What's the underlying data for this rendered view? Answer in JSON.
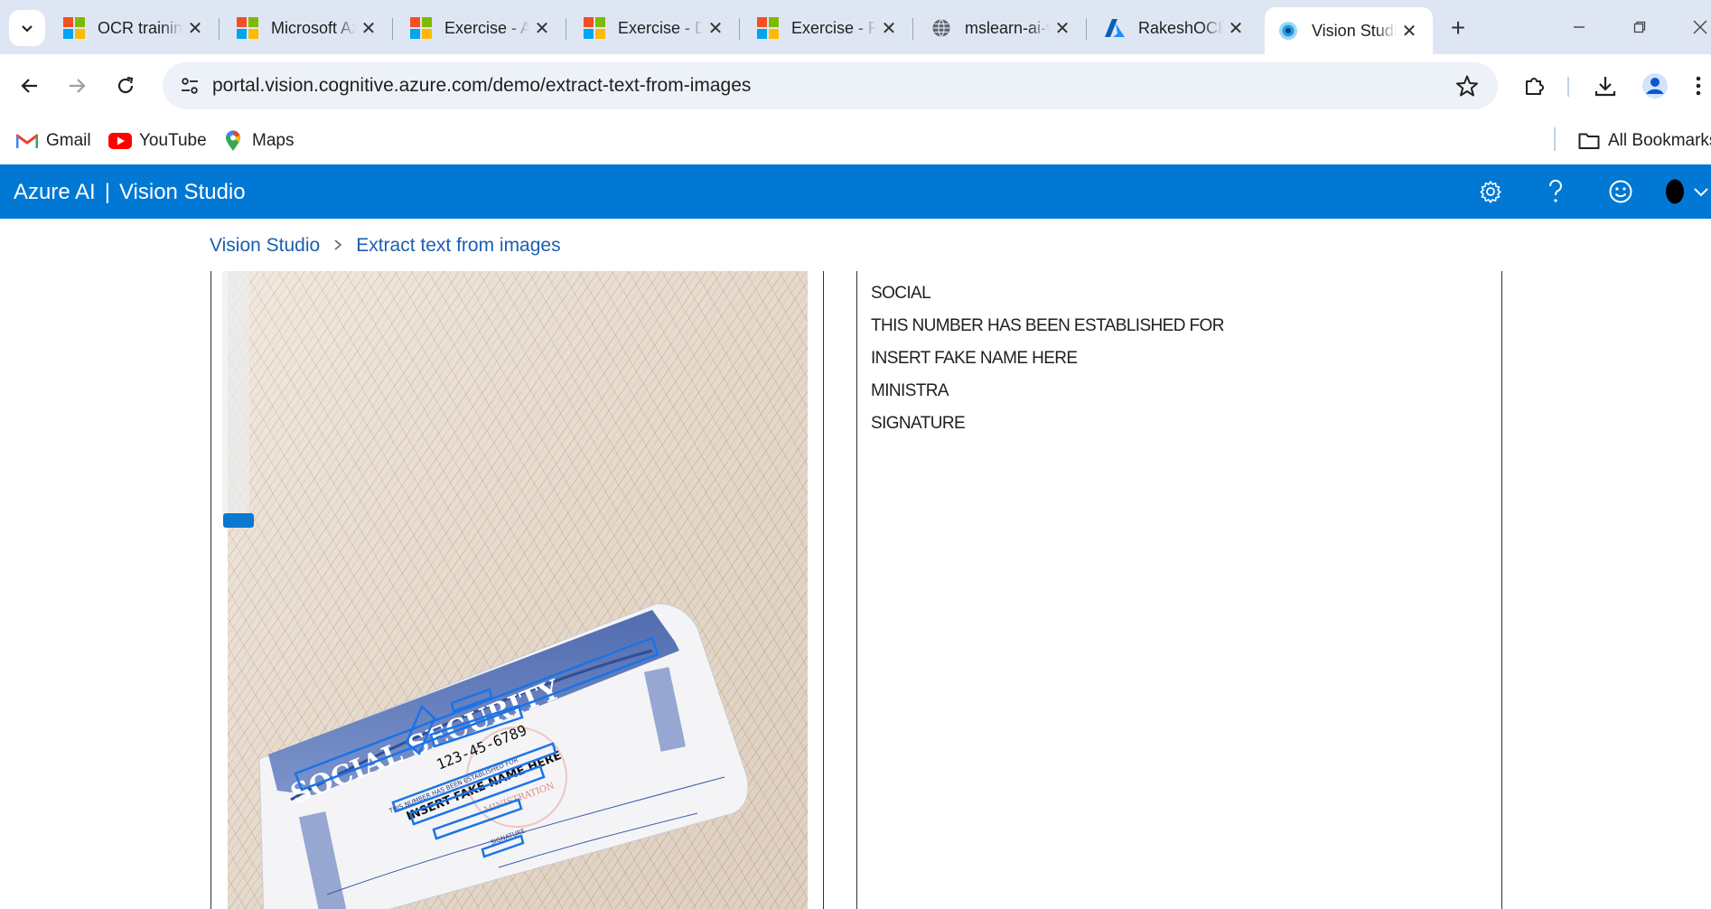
{
  "browser": {
    "tabs": [
      {
        "title": "OCR training",
        "favicon": "microsoft-logo-icon",
        "active": false
      },
      {
        "title": "Microsoft Azure",
        "favicon": "microsoft-logo-icon",
        "active": false
      },
      {
        "title": "Exercise - Azure",
        "favicon": "microsoft-logo-icon",
        "active": false
      },
      {
        "title": "Exercise - Detect",
        "favicon": "microsoft-logo-icon",
        "active": false
      },
      {
        "title": "Exercise - Read",
        "favicon": "microsoft-logo-icon",
        "active": false
      },
      {
        "title": "mslearn-ai-vision",
        "favicon": "globe-icon",
        "active": false
      },
      {
        "title": "RakeshOCR",
        "favicon": "azure-logo-icon",
        "active": false
      },
      {
        "title": "Vision Studio",
        "favicon": "vision-studio-icon",
        "active": true
      }
    ],
    "url": "portal.vision.cognitive.azure.com/demo/extract-text-from-images",
    "bookmarks": [
      {
        "label": "Gmail",
        "icon": "gmail-icon"
      },
      {
        "label": "YouTube",
        "icon": "youtube-icon"
      },
      {
        "label": "Maps",
        "icon": "maps-icon"
      }
    ],
    "all_bookmarks_label": "All Bookmarks"
  },
  "app": {
    "brand_left": "Azure AI",
    "brand_sep": "|",
    "brand_right": "Vision Studio",
    "header_icons": [
      "settings-icon",
      "help-icon",
      "feedback-smiley-icon",
      "account-avatar-icon",
      "chevron-down-icon"
    ]
  },
  "breadcrumb": {
    "items": [
      "Vision Studio",
      "Extract text from images"
    ],
    "separator": ">"
  },
  "result": {
    "lines": [
      "SOCIAL",
      "THIS NUMBER HAS BEEN ESTABLISHED FOR",
      "INSERT FAKE NAME HERE",
      "MINISTRA",
      "SIGNATURE"
    ]
  },
  "card_image": {
    "title_text": "SOCIAL SECURITY",
    "number_text": "123-45-6789",
    "line1_text": "THIS NUMBER HAS BEEN ESTABLISHED FOR",
    "name_text": "INSERT FAKE NAME HERE",
    "seal_text": "MINISTRATION",
    "signature_text": "SIGNATURE"
  },
  "colors": {
    "azure_blue": "#0078d4",
    "tab_strip": "#dfe6f3",
    "link": "#1b5fb0",
    "bounding_box": "#1a73e8"
  }
}
